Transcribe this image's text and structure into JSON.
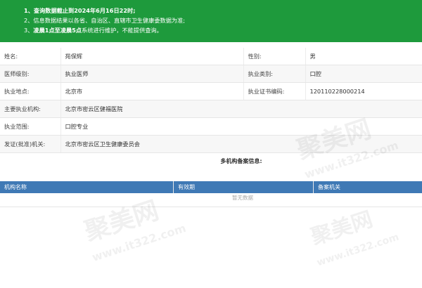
{
  "notice": {
    "line1": "1、查询数据截止到2024年6月16日22时;",
    "line2": "2、信息数据结果以各省、自治区、直辖市卫生健康委数据为准;",
    "line3_prefix": "3、",
    "line3_hl1": "凌晨1点至凌晨5点",
    "line3_suffix": "系统进行维护，不能提供查询。"
  },
  "fields": {
    "name_label": "姓名:",
    "name_value": "苑保辉",
    "gender_label": "性别:",
    "gender_value": "男",
    "level_label": "医师级别:",
    "level_value": "执业医师",
    "category_label": "执业类别:",
    "category_value": "口腔",
    "location_label": "执业地点:",
    "location_value": "北京市",
    "cert_label": "执业证书编码:",
    "cert_value": "120110228000214",
    "institution_label": "主要执业机构:",
    "institution_value": "北京市密云区健福医院",
    "scope_label": "执业范围:",
    "scope_value": "口腔专业",
    "issuer_label": "发证(批准)机关:",
    "issuer_value": "北京市密云区卫生健康委员会"
  },
  "multi": {
    "title": "多机构备案信息:",
    "col_org": "机构名称",
    "col_valid": "有效期",
    "col_agency": "备案机关",
    "empty": "暂无数据"
  },
  "watermark": {
    "brand": "聚美网",
    "url": "www.it322.com"
  }
}
